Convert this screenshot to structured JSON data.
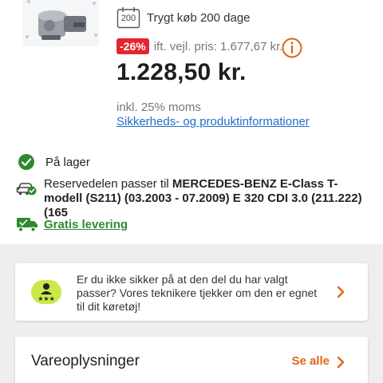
{
  "product": {
    "return_text": "Trygt køb 200 dage",
    "return_badge": "200",
    "discount": "-26%",
    "rrp_text": "ift. vejl. pris: 1.677,67 kr.",
    "price": "1.228,50 kr.",
    "vat_text": "inkl. 25% moms",
    "safety_link": "Sikkerheds- og produktinformationer"
  },
  "stock": {
    "label": "På lager"
  },
  "fitment": {
    "prefix": "Reservedelen passer til ",
    "vehicle": "MERCEDES-BENZ E-Class T-modell (S211) (03.2003 - 07.2009) E 320 CDI 3.0 (211.222) (165"
  },
  "shipping": {
    "label": "Gratis levering"
  },
  "help": {
    "text": "Er du ikke sikker på at den del du har valgt passer? Vores teknikere tjekker om den er egnet til dit køretøj!"
  },
  "details": {
    "title": "Vareoplysninger",
    "see_all": "Se alle"
  },
  "colors": {
    "accent_orange": "#e0661b",
    "discount_red": "#e3262d",
    "stock_green": "#2d8a2d",
    "link_blue": "#1f6fc9"
  }
}
